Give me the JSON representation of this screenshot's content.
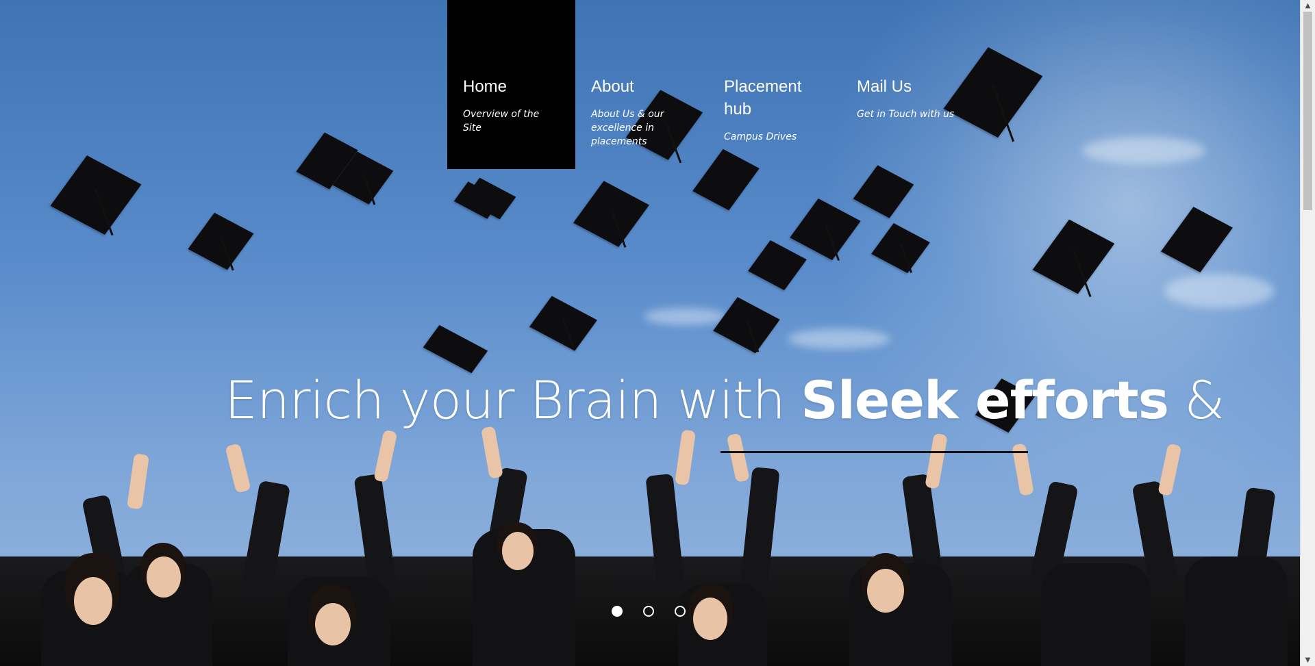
{
  "nav": {
    "items": [
      {
        "title": "Home",
        "subtitle": "Overview of the Site"
      },
      {
        "title": "About",
        "subtitle": "About Us & our excellence in placements"
      },
      {
        "title": "Placement hub",
        "subtitle": "Campus Drives"
      },
      {
        "title": "Mail Us",
        "subtitle": "Get in Touch with us"
      }
    ]
  },
  "hero": {
    "headline_start": "Enrich your Brain with ",
    "headline_bold": "Sleek efforts",
    "headline_end": " &"
  },
  "slider": {
    "total_slides": 3,
    "active_index": 1
  },
  "scrollbar": {
    "up_icon": "triangle-up-icon",
    "down_icon": "triangle-down-icon"
  },
  "colors": {
    "nav_active_bg": "#000000",
    "text": "#ffffff",
    "underline": "#111111"
  }
}
